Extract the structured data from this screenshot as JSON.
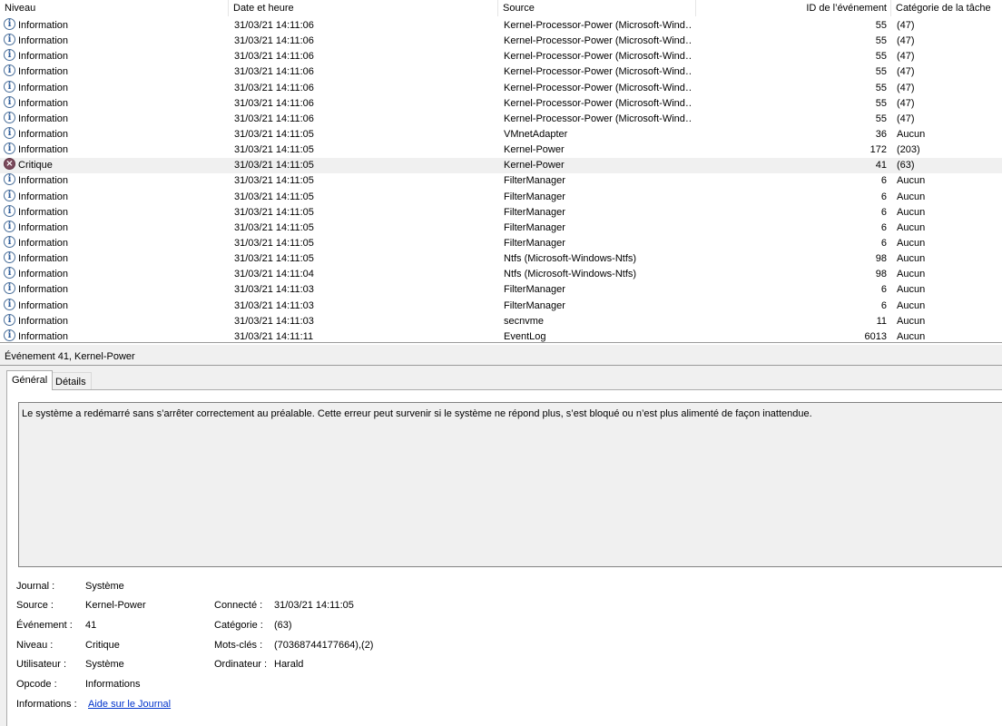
{
  "columns": {
    "level": "Niveau",
    "date": "Date et heure",
    "source": "Source",
    "event_id": "ID de l’événement",
    "category": "Catégorie de la tâche"
  },
  "events": [
    {
      "level": "Information",
      "date": "31/03/21 14:11:06",
      "source": "Kernel-Processor-Power (Microsoft-Wind…",
      "id": "55",
      "category": "(47)",
      "icon": "info"
    },
    {
      "level": "Information",
      "date": "31/03/21 14:11:06",
      "source": "Kernel-Processor-Power (Microsoft-Wind…",
      "id": "55",
      "category": "(47)",
      "icon": "info"
    },
    {
      "level": "Information",
      "date": "31/03/21 14:11:06",
      "source": "Kernel-Processor-Power (Microsoft-Wind…",
      "id": "55",
      "category": "(47)",
      "icon": "info"
    },
    {
      "level": "Information",
      "date": "31/03/21 14:11:06",
      "source": "Kernel-Processor-Power (Microsoft-Wind…",
      "id": "55",
      "category": "(47)",
      "icon": "info"
    },
    {
      "level": "Information",
      "date": "31/03/21 14:11:06",
      "source": "Kernel-Processor-Power (Microsoft-Wind…",
      "id": "55",
      "category": "(47)",
      "icon": "info"
    },
    {
      "level": "Information",
      "date": "31/03/21 14:11:06",
      "source": "Kernel-Processor-Power (Microsoft-Wind…",
      "id": "55",
      "category": "(47)",
      "icon": "info"
    },
    {
      "level": "Information",
      "date": "31/03/21 14:11:06",
      "source": "Kernel-Processor-Power (Microsoft-Wind…",
      "id": "55",
      "category": "(47)",
      "icon": "info"
    },
    {
      "level": "Information",
      "date": "31/03/21 14:11:05",
      "source": "VMnetAdapter",
      "id": "36",
      "category": "Aucun",
      "icon": "info"
    },
    {
      "level": "Information",
      "date": "31/03/21 14:11:05",
      "source": "Kernel-Power",
      "id": "172",
      "category": "(203)",
      "icon": "info"
    },
    {
      "level": "Critique",
      "date": "31/03/21 14:11:05",
      "source": "Kernel-Power",
      "id": "41",
      "category": "(63)",
      "icon": "critical",
      "selected": true
    },
    {
      "level": "Information",
      "date": "31/03/21 14:11:05",
      "source": "FilterManager",
      "id": "6",
      "category": "Aucun",
      "icon": "info"
    },
    {
      "level": "Information",
      "date": "31/03/21 14:11:05",
      "source": "FilterManager",
      "id": "6",
      "category": "Aucun",
      "icon": "info"
    },
    {
      "level": "Information",
      "date": "31/03/21 14:11:05",
      "source": "FilterManager",
      "id": "6",
      "category": "Aucun",
      "icon": "info"
    },
    {
      "level": "Information",
      "date": "31/03/21 14:11:05",
      "source": "FilterManager",
      "id": "6",
      "category": "Aucun",
      "icon": "info"
    },
    {
      "level": "Information",
      "date": "31/03/21 14:11:05",
      "source": "FilterManager",
      "id": "6",
      "category": "Aucun",
      "icon": "info"
    },
    {
      "level": "Information",
      "date": "31/03/21 14:11:05",
      "source": "Ntfs (Microsoft-Windows-Ntfs)",
      "id": "98",
      "category": "Aucun",
      "icon": "info"
    },
    {
      "level": "Information",
      "date": "31/03/21 14:11:04",
      "source": "Ntfs (Microsoft-Windows-Ntfs)",
      "id": "98",
      "category": "Aucun",
      "icon": "info"
    },
    {
      "level": "Information",
      "date": "31/03/21 14:11:03",
      "source": "FilterManager",
      "id": "6",
      "category": "Aucun",
      "icon": "info"
    },
    {
      "level": "Information",
      "date": "31/03/21 14:11:03",
      "source": "FilterManager",
      "id": "6",
      "category": "Aucun",
      "icon": "info"
    },
    {
      "level": "Information",
      "date": "31/03/21 14:11:03",
      "source": "secnvme",
      "id": "11",
      "category": "Aucun",
      "icon": "info"
    },
    {
      "level": "Information",
      "date": "31/03/21 14:11:11",
      "source": "EventLog",
      "id": "6013",
      "category": "Aucun",
      "icon": "info"
    }
  ],
  "detail": {
    "title": "Événement 41, Kernel-Power",
    "tabs": {
      "general": "Général",
      "details": "Détails"
    },
    "description": "Le système a redémarré sans s’arrêter correctement au préalable. Cette erreur peut survenir si le système ne répond plus, s’est bloqué ou n’est plus alimenté de façon inattendue.",
    "fields": {
      "journal": {
        "label": "Journal :",
        "value": "Système"
      },
      "source": {
        "label": "Source :",
        "value": "Kernel-Power"
      },
      "event": {
        "label": "Événement :",
        "value": "41"
      },
      "level": {
        "label": "Niveau :",
        "value": "Critique"
      },
      "user": {
        "label": "Utilisateur :",
        "value": "Système"
      },
      "opcode": {
        "label": "Opcode :",
        "value": "Informations"
      },
      "info": {
        "label": "Informations :",
        "value": "Aide sur le Journal"
      },
      "logged": {
        "label": "Connecté :",
        "value": "31/03/21 14:11:05"
      },
      "category": {
        "label": "Catégorie :",
        "value": "(63)"
      },
      "keywords": {
        "label": "Mots-clés :",
        "value": "(70368744177664),(2)"
      },
      "computer": {
        "label": "Ordinateur :",
        "value": "Harald"
      }
    }
  }
}
